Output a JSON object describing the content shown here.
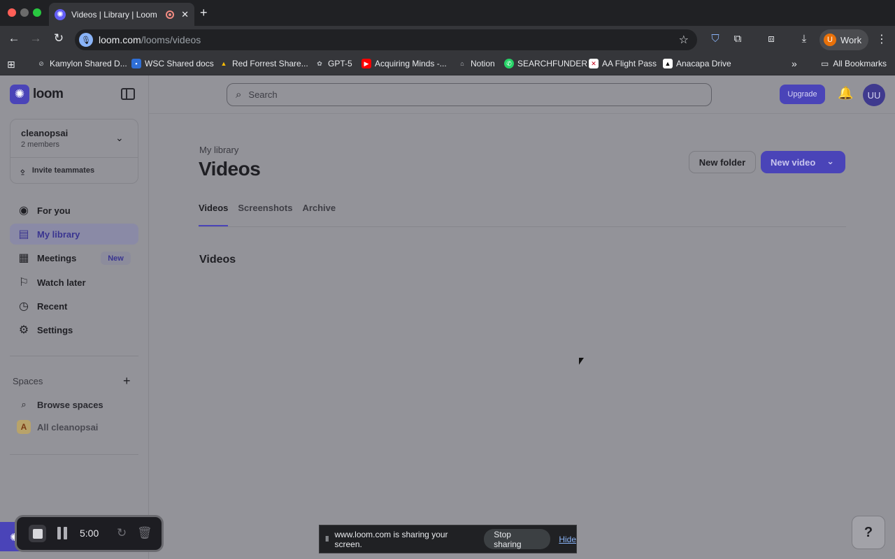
{
  "browser": {
    "tab_title": "Videos | Library | Loom",
    "url_host": "loom.com",
    "url_path": "/looms/videos",
    "profile_initial": "U",
    "profile_label": "Work",
    "bookmarks": [
      {
        "label": "Kamylon Shared D...",
        "icon": "link-icon"
      },
      {
        "label": "WSC Shared docs",
        "icon": "folder-icon"
      },
      {
        "label": "Red Forrest Share...",
        "icon": "drive-icon"
      },
      {
        "label": "GPT-5",
        "icon": "openai-icon"
      },
      {
        "label": "Acquiring Minds -...",
        "icon": "youtube-icon"
      },
      {
        "label": "Notion",
        "icon": "home-icon"
      },
      {
        "label": "SEARCHFUNDER",
        "icon": "whatsapp-icon"
      },
      {
        "label": "AA Flight Pass",
        "icon": "aa-icon"
      },
      {
        "label": "Anacapa Drive",
        "icon": "anacapa-icon"
      }
    ],
    "all_bookmarks": "All Bookmarks"
  },
  "sidebar": {
    "logo_text": "loom",
    "workspace": {
      "name": "cleanopsai",
      "members": "2 members",
      "invite": "Invite teammates"
    },
    "nav": [
      {
        "label": "For you",
        "icon": "user-circle-icon"
      },
      {
        "label": "My library",
        "icon": "library-icon"
      },
      {
        "label": "Meetings",
        "icon": "calendar-icon",
        "badge": "New"
      },
      {
        "label": "Watch later",
        "icon": "bookmark-icon"
      },
      {
        "label": "Recent",
        "icon": "clock-icon"
      },
      {
        "label": "Settings",
        "icon": "gear-icon"
      }
    ],
    "spaces_label": "Spaces",
    "spaces": [
      {
        "label": "Browse spaces",
        "icon": "search-icon"
      },
      {
        "label": "All cleanopsai",
        "icon_letter": "A"
      }
    ]
  },
  "topbar": {
    "search_placeholder": "Search",
    "upgrade": "Upgrade",
    "user_initials": "UU"
  },
  "main": {
    "breadcrumb": "My library",
    "title": "Videos",
    "new_folder": "New folder",
    "new_video": "New video",
    "tabs": [
      "Videos",
      "Screenshots",
      "Archive"
    ],
    "section_heading": "Videos"
  },
  "help": {
    "label": "?"
  },
  "recorder": {
    "time": "5:00"
  },
  "sharing": {
    "message": "www.loom.com is sharing your screen.",
    "stop": "Stop sharing",
    "hide": "Hide"
  },
  "colors": {
    "accent": "#4a44b8",
    "page_bg": "#939399",
    "chrome_bg": "#35363a"
  }
}
